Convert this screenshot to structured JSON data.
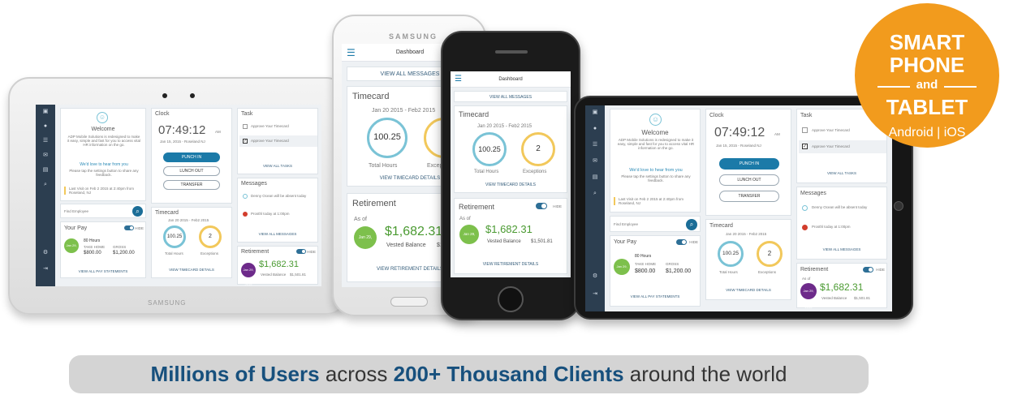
{
  "badge": {
    "line1": "SMART",
    "line2": "PHONE",
    "line3": "and",
    "line4": "TABLET",
    "platforms": "Android | iOS",
    "color": "#f29b1d"
  },
  "banner": {
    "part1": "Millions of Users",
    "part2": " across ",
    "part3": "200+ Thousand Clients",
    "part4": " around the world"
  },
  "devices": {
    "samsung_brand": "SAMSUNG",
    "tablet_brand": "SAMSUNG"
  },
  "dashboard": {
    "title": "Dashboard",
    "nav": [
      "ADP Mobile",
      "Myself",
      "My Team",
      "Inbox",
      "Schedule",
      "Search",
      "Settings",
      "Logout"
    ],
    "welcome": {
      "heading": "Welcome",
      "body": "ADP Mobile Solutions is redesigned to make it easy, simple and fast for you to access vital HR information on the go.",
      "cta": "We'd love to hear from you",
      "cta_body": "Please tap the settings button to share any feedback.",
      "last_visit": "Last Visit on Feb 2 2015 at 2:40pm from Roseland, NJ",
      "find_placeholder": "Find Employee"
    },
    "clock": {
      "title": "Clock",
      "time": "07:49:12",
      "ampm": "AM",
      "date": "Jan 15, 2015 - Roseland NJ",
      "punch_in": "PUNCH IN",
      "lunch_out": "LUNCH OUT",
      "transfer": "TRANSFER"
    },
    "task": {
      "title": "Task",
      "items": [
        "Approve Your Timecard",
        "Approve Your Timecard"
      ],
      "view_all": "VIEW ALL TASKS"
    },
    "messages": {
      "title": "Messages",
      "items": [
        "Denny Ocean will be absent today",
        "Prosthl today at 1:00pm"
      ],
      "view_all": "VIEW ALL MESSAGES"
    },
    "timecard": {
      "title": "Timecard",
      "range": "Jan 20 2015 - Feb2 2015",
      "hours": "100.25",
      "hours_label": "Total Hours",
      "exceptions": "2",
      "exceptions_label": "Exceptions",
      "view": "VIEW TIMECARD DETAILS"
    },
    "pay": {
      "title": "Your Pay",
      "hide": "HIDE",
      "date": "Jan 29, 2015",
      "hours": "80 Hours",
      "take_home_label": "TAKE HOME",
      "take_home": "$800.00",
      "gross_label": "GROSS",
      "gross": "$1,200.00",
      "view": "VIEW ALL PAY STATEMENTS"
    },
    "retirement": {
      "title": "Retirement",
      "hide": "HIDE",
      "as_of": "As of",
      "date": "Jan 29, 2015",
      "amount": "$1,682.31",
      "vested_label": "Vested Balance",
      "vested": "$1,501.81",
      "view": "VIEW RETIREMENT DETAILS"
    }
  }
}
